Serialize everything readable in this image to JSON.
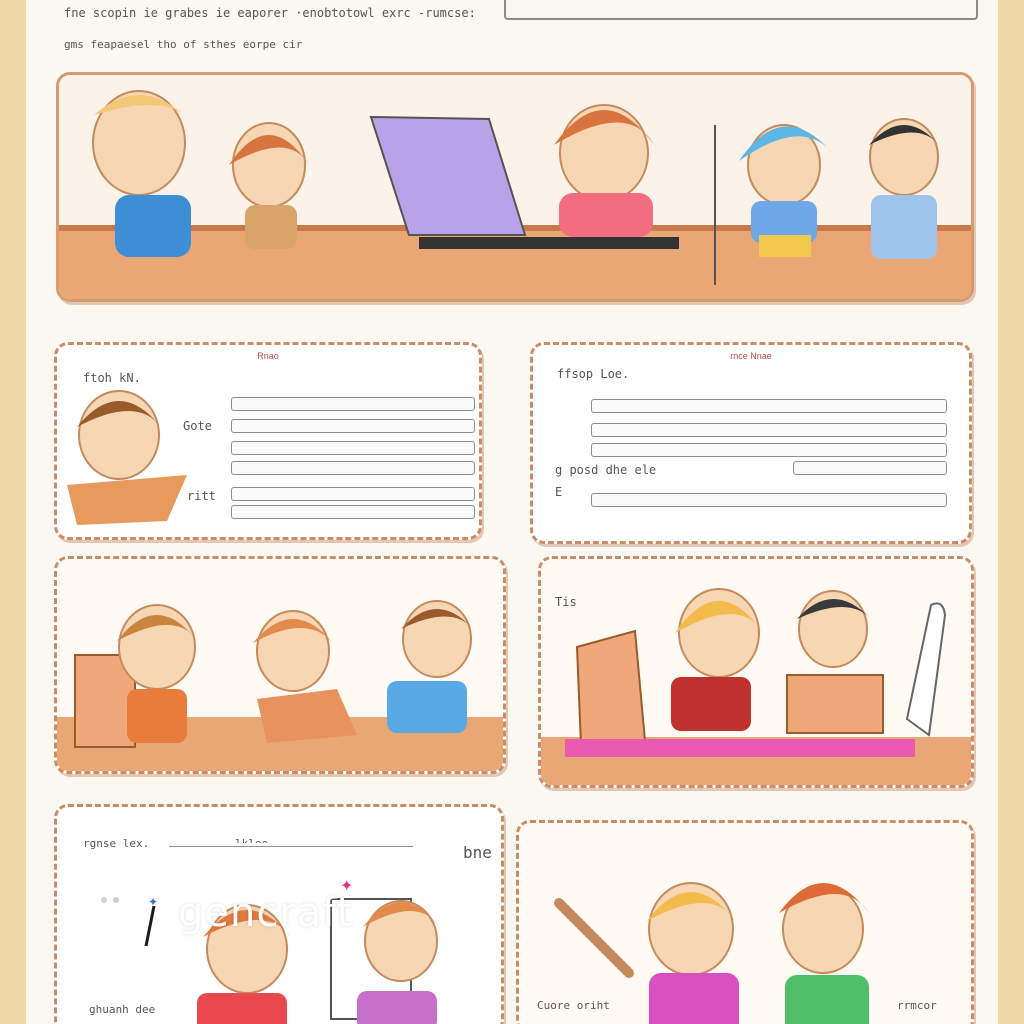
{
  "header": {
    "line1": "fne  scopin ie  grabes ie  eaporer ·enobtotowl  exrc -rumcse:",
    "line2": "gms  feapaesel  tho  of  sthes  eorpe cir"
  },
  "panels": {
    "middle_left": {
      "caption": "Rnao",
      "labels": [
        "ftoh kN.",
        "Gote",
        "ritt"
      ]
    },
    "middle_right": {
      "caption": "rnce Nnae",
      "labels": [
        "ffsop  Loe.",
        "g posd  dhe  ele",
        "E"
      ]
    },
    "lower_left": {
      "caption": "—"
    },
    "lower_right": {
      "corner_label": "Tis"
    },
    "bottom_left": {
      "labels": [
        "rgnse  lex.",
        "lklee",
        "ghuanh  dee",
        "bne  dhe:"
      ]
    },
    "bottom_right": {
      "labels": [
        "Cuore  oriht",
        "rrmcor"
      ]
    }
  },
  "logo": {
    "text": "gencraft"
  },
  "colors": {
    "background": "#eed9a6",
    "sheet": "#fbf7f1",
    "panel_border": "#c98c66",
    "desk": "#e8a774",
    "laptop": "#b9a3e8"
  }
}
